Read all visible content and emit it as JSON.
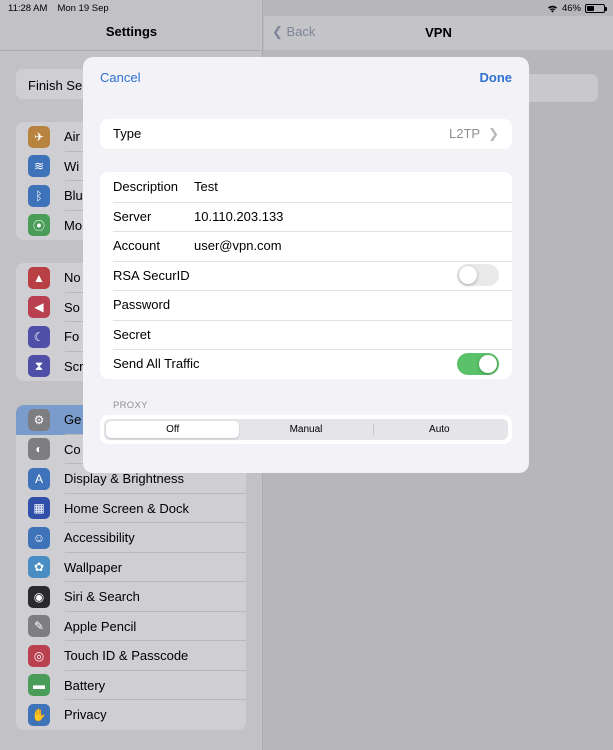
{
  "status": {
    "time": "11:28 AM",
    "date": "Mon 19 Sep",
    "battery": "46%",
    "battery_fraction": 0.46
  },
  "sidebar": {
    "title": "Settings",
    "finish": "Finish Se",
    "group1": [
      {
        "label": "Air",
        "icon": "airplane-icon",
        "color": "#b8823f"
      },
      {
        "label": "Wi",
        "icon": "wifi-icon",
        "color": "#3f73b9"
      },
      {
        "label": "Blu",
        "icon": "bluetooth-icon",
        "color": "#3f73b9"
      },
      {
        "label": "Mo",
        "icon": "cellular-icon",
        "color": "#4a9d58"
      }
    ],
    "group2": [
      {
        "label": "No",
        "icon": "notifications-icon",
        "color": "#b84045"
      },
      {
        "label": "So",
        "icon": "sounds-icon",
        "color": "#b8404f"
      },
      {
        "label": "Fo",
        "icon": "focus-icon",
        "color": "#4f4fa8"
      },
      {
        "label": "Scr",
        "icon": "screen-time-icon",
        "color": "#4f4fa8"
      }
    ],
    "group3": [
      {
        "label": "Ge",
        "icon": "gear-icon",
        "color": "#7d7d82"
      },
      {
        "label": "Co",
        "icon": "control-centre-icon",
        "color": "#7d7d82"
      },
      {
        "label": "Display & Brightness",
        "icon": "display-icon",
        "color": "#3f73b9"
      },
      {
        "label": "Home Screen & Dock",
        "icon": "home-screen-icon",
        "color": "#2f4fa8"
      },
      {
        "label": "Accessibility",
        "icon": "accessibility-icon",
        "color": "#3f73b9"
      },
      {
        "label": "Wallpaper",
        "icon": "wallpaper-icon",
        "color": "#4a8dc4"
      },
      {
        "label": "Siri & Search",
        "icon": "siri-icon",
        "color": "#2a2a2e"
      },
      {
        "label": "Apple Pencil",
        "icon": "pencil-icon",
        "color": "#7d7d82"
      },
      {
        "label": "Touch ID & Passcode",
        "icon": "fingerprint-icon",
        "color": "#b8404f"
      },
      {
        "label": "Battery",
        "icon": "battery-icon",
        "color": "#4a9d58"
      },
      {
        "label": "Privacy",
        "icon": "hand-icon",
        "color": "#3f73b9"
      }
    ]
  },
  "detail": {
    "back": "Back",
    "title": "VPN"
  },
  "modal": {
    "cancel": "Cancel",
    "done": "Done",
    "type_label": "Type",
    "type_value": "L2TP",
    "fields": {
      "description_label": "Description",
      "description_value": "Test",
      "server_label": "Server",
      "server_value": "10.110.203.133",
      "account_label": "Account",
      "account_value": "user@vpn.com",
      "rsa_label": "RSA SecurID",
      "rsa_on": false,
      "password_label": "Password",
      "password_value": "",
      "secret_label": "Secret",
      "secret_value": "",
      "send_all_label": "Send All Traffic",
      "send_all_on": true
    },
    "proxy_header": "PROXY",
    "proxy_options": [
      "Off",
      "Manual",
      "Auto"
    ],
    "proxy_selected": "Off"
  }
}
